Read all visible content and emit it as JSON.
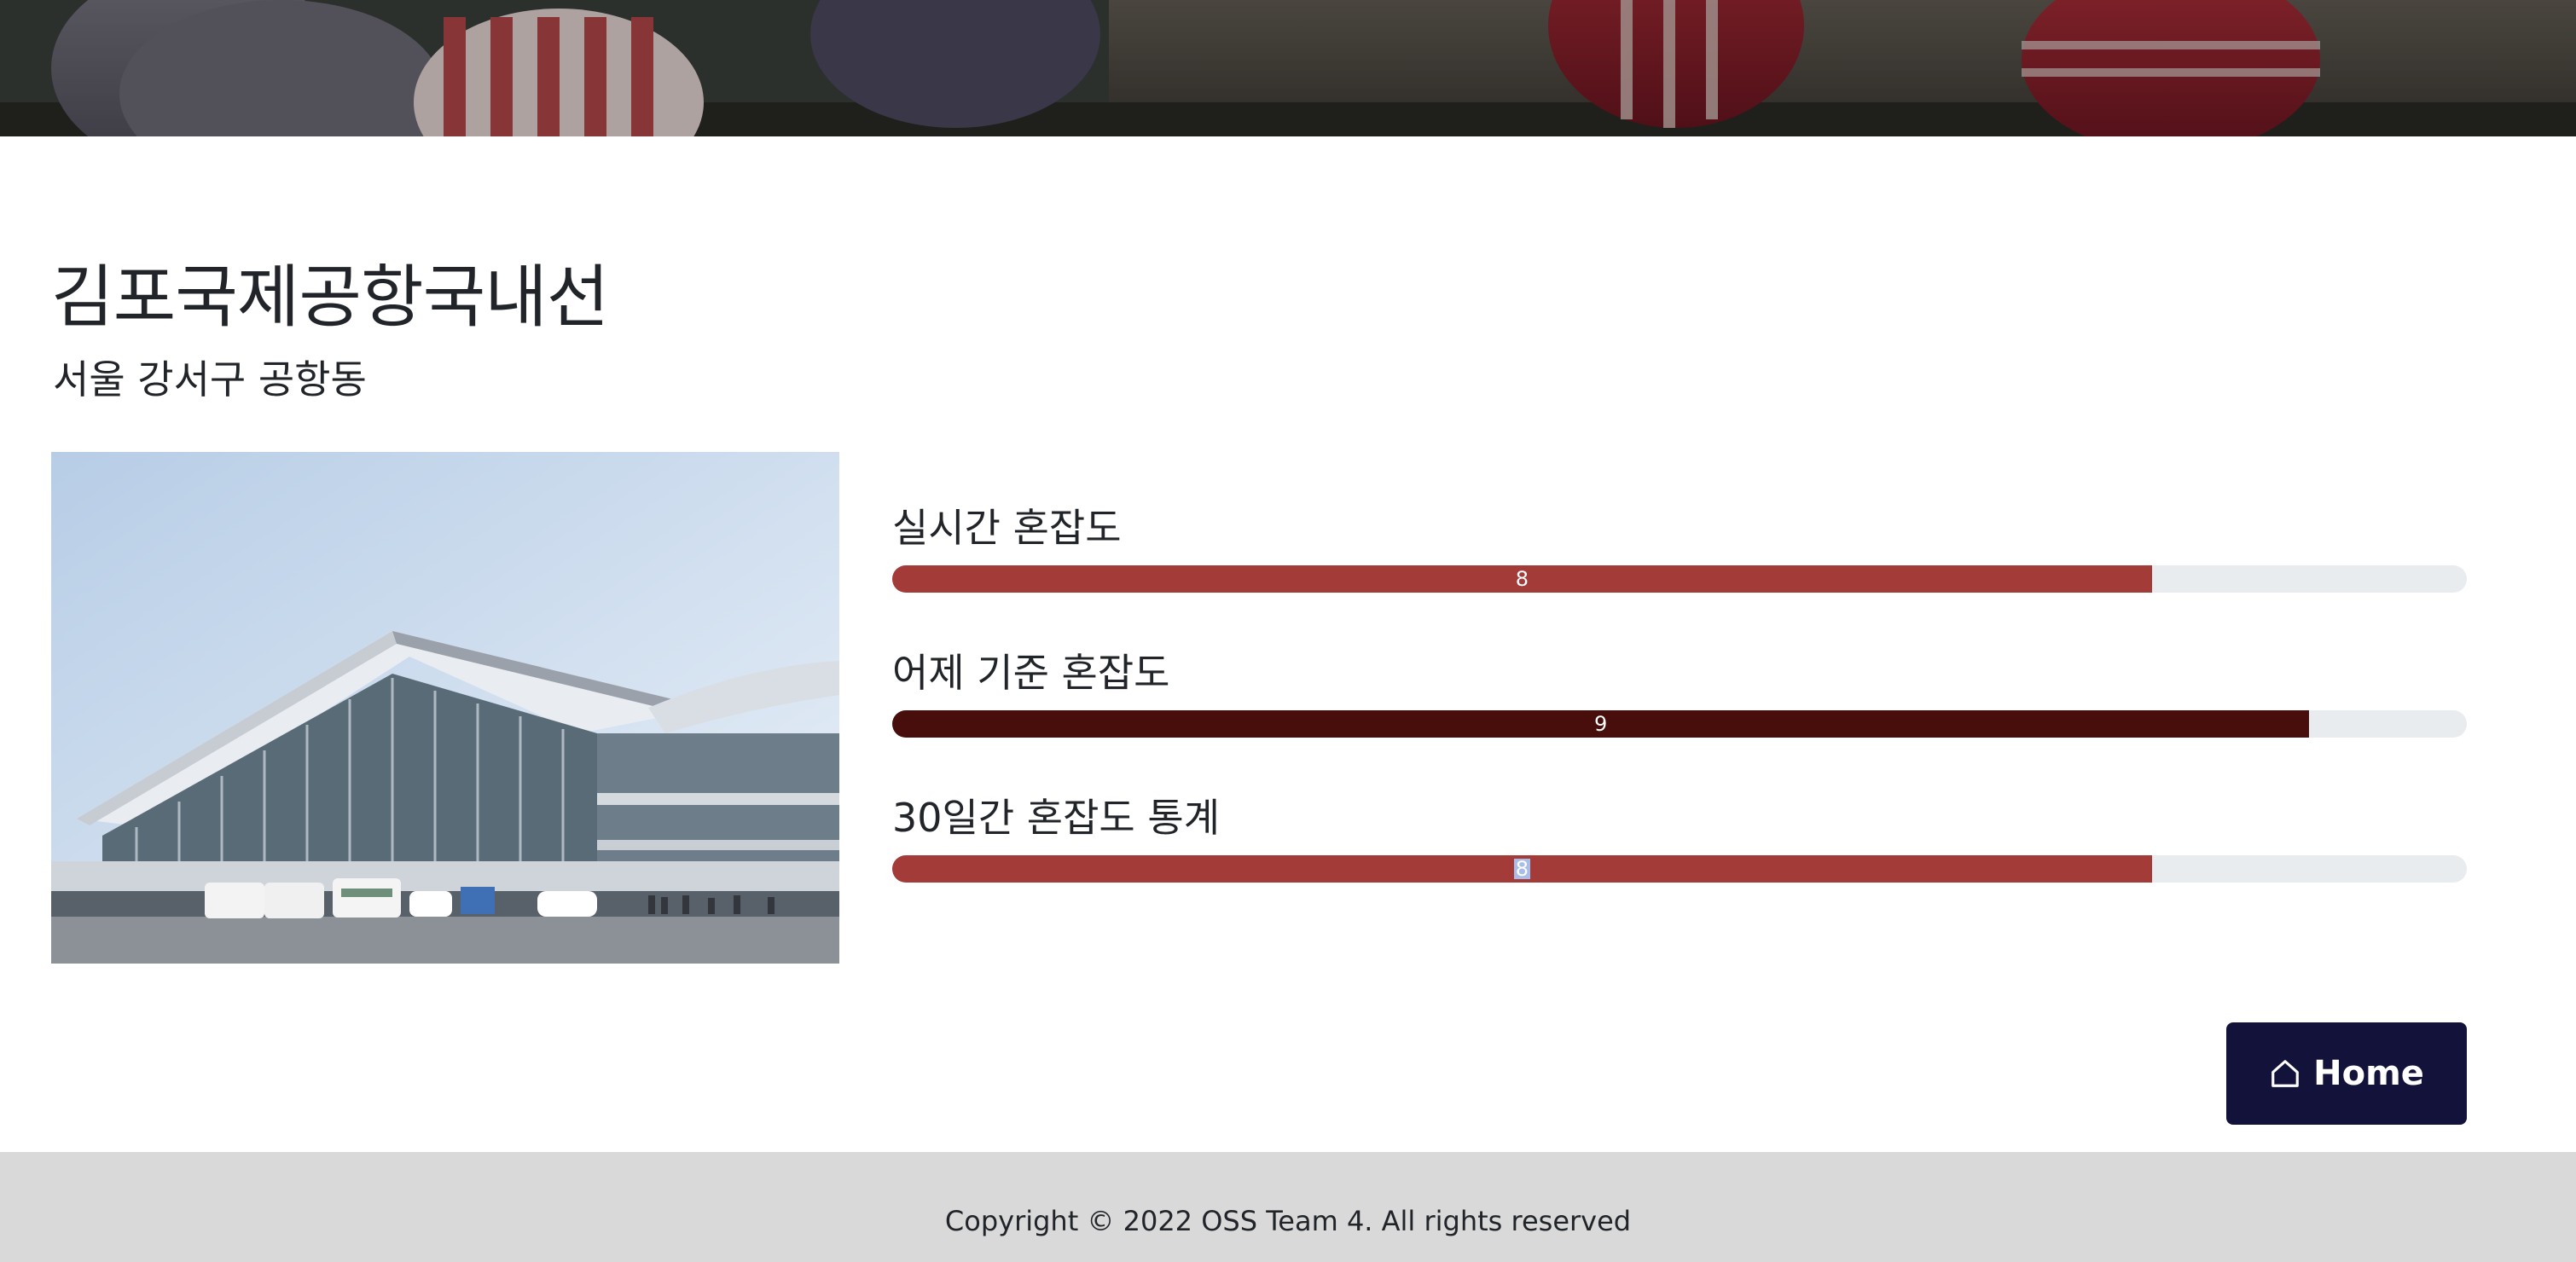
{
  "place": {
    "name": "김포국제공항국내선",
    "address": "서울 강서구 공항동"
  },
  "congestion": [
    {
      "label": "실시간 혼잡도",
      "value": "8",
      "level": 0.8,
      "color": "#a33b39",
      "selected": false
    },
    {
      "label": "어제 기준 혼잡도",
      "value": "9",
      "level": 0.9,
      "color": "#470e0b",
      "selected": false
    },
    {
      "label": "30일간 혼잡도 통계",
      "value": "8",
      "level": 0.8,
      "color": "#a33b39",
      "selected": true
    }
  ],
  "home_button": {
    "label": "Home",
    "icon": "house-icon"
  },
  "footer": {
    "copyright": "Copyright © 2022 OSS Team 4. All rights reserved"
  },
  "colors": {
    "bar_track": "#e9ecef",
    "home_button_bg": "#13123a",
    "footer_bg": "#d9d9d9"
  }
}
